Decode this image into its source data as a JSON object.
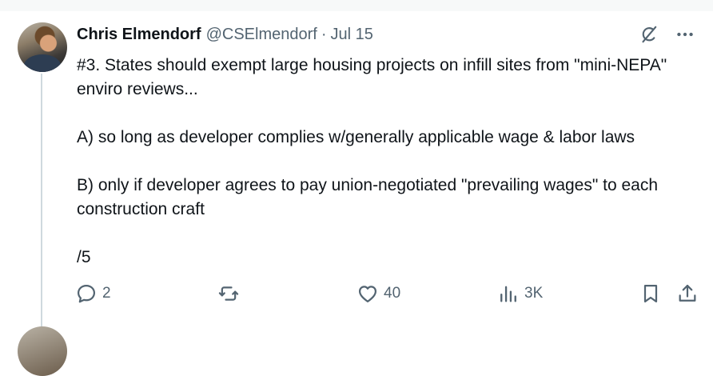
{
  "tweet": {
    "author_name": "Chris Elmendorf",
    "author_handle": "@CSElmendorf",
    "separator": "·",
    "date": "Jul 15",
    "paragraphs": [
      "#3. States should exempt large housing projects on infill sites from \"mini-NEPA\" enviro reviews...",
      "A) so long as developer complies w/generally applicable wage & labor laws",
      "B) only if developer agrees to pay union-negotiated \"prevailing wages\" to each construction craft",
      "/5"
    ]
  },
  "actions": {
    "replies": "2",
    "reposts": "",
    "likes": "40",
    "views": "3K"
  },
  "icons": {
    "grok": "grok-icon",
    "more": "more-icon",
    "reply": "reply-icon",
    "repost": "repost-icon",
    "like": "heart-icon",
    "views": "views-icon",
    "bookmark": "bookmark-icon",
    "share": "share-icon"
  },
  "colors": {
    "text": "#0f1419",
    "secondary": "#536471",
    "thread_line": "#cfd9de"
  }
}
